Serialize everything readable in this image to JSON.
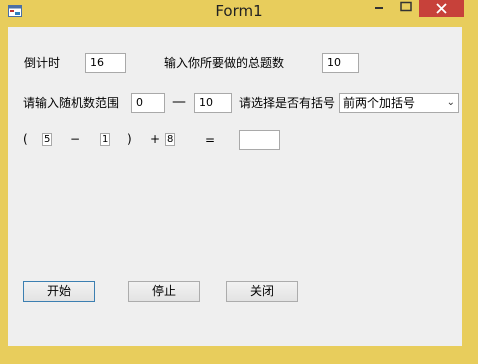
{
  "window": {
    "title": "Form1"
  },
  "countdown": {
    "label": "倒计时",
    "value": "16"
  },
  "total_questions": {
    "label": "输入你所要做的总题数",
    "value": "10"
  },
  "range": {
    "label": "请输入随机数范围",
    "min": "0",
    "separator": "—",
    "max": "10"
  },
  "brackets": {
    "label": "请选择是否有括号",
    "selected": "前两个加括号"
  },
  "equation": {
    "open_paren": "(",
    "operand1": "5",
    "operator1": "−",
    "operand2": "1",
    "close_paren": ")",
    "operator2": "+",
    "operand3": "8",
    "equals": "=",
    "answer": ""
  },
  "buttons": {
    "start": "开始",
    "stop": "停止",
    "close": "关闭"
  }
}
